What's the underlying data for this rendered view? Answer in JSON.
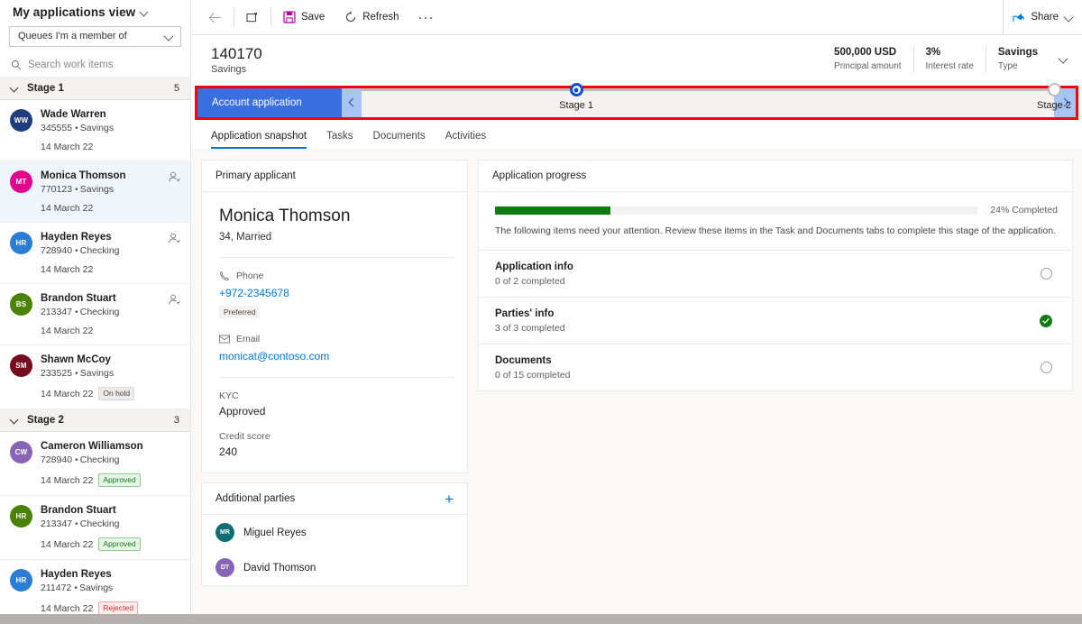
{
  "sidebar": {
    "view_title": "My applications view",
    "queue_selector_value": "Queues I'm a member of",
    "search_placeholder": "Search work items",
    "groups": [
      {
        "name": "Stage 1",
        "count": "5",
        "items": [
          {
            "initials": "WW",
            "color": "#1f3d7a",
            "name": "Wade Warren",
            "id": "345555",
            "type": "Savings",
            "date": "14 March 22",
            "badge": "",
            "badge_kind": "",
            "assign_icon": false,
            "selected": false
          },
          {
            "initials": "MT",
            "color": "#e3008c",
            "name": "Monica Thomson",
            "id": "770123",
            "type": "Savings",
            "date": "14 March 22",
            "badge": "",
            "badge_kind": "",
            "assign_icon": true,
            "selected": true
          },
          {
            "initials": "HR",
            "color": "#2b7cd3",
            "name": "Hayden Reyes",
            "id": "728940",
            "type": "Checking",
            "date": "14 March 22",
            "badge": "",
            "badge_kind": "",
            "assign_icon": true,
            "selected": false
          },
          {
            "initials": "BS",
            "color": "#498205",
            "name": "Brandon Stuart",
            "id": "213347",
            "type": "Checking",
            "date": "14 March 22",
            "badge": "",
            "badge_kind": "",
            "assign_icon": true,
            "selected": false
          },
          {
            "initials": "SM",
            "color": "#750b1c",
            "name": "Shawn McCoy",
            "id": "233525",
            "type": "Savings",
            "date": "14 March 22",
            "badge": "On hold",
            "badge_kind": "hold",
            "assign_icon": false,
            "selected": false
          }
        ]
      },
      {
        "name": "Stage 2",
        "count": "3",
        "items": [
          {
            "initials": "CW",
            "color": "#8764b8",
            "name": "Cameron Williamson",
            "id": "728940",
            "type": "Checking",
            "date": "14 March 22",
            "badge": "Approved",
            "badge_kind": "approved",
            "assign_icon": false,
            "selected": false
          },
          {
            "initials": "HR",
            "color": "#498205",
            "name": "Brandon Stuart",
            "id": "213347",
            "type": "Checking",
            "date": "14 March 22",
            "badge": "Approved",
            "badge_kind": "approved",
            "assign_icon": false,
            "selected": false
          },
          {
            "initials": "HR",
            "color": "#2b7cd3",
            "name": "Hayden Reyes",
            "id": "211472",
            "type": "Savings",
            "date": "14 March 22",
            "badge": "Rejected",
            "badge_kind": "rejected",
            "assign_icon": false,
            "selected": false
          }
        ]
      }
    ],
    "separator_dot": "•"
  },
  "commandbar": {
    "back_icon": "back-arrow-icon",
    "new_icon": "new-window-icon",
    "save_label": "Save",
    "refresh_label": "Refresh",
    "overflow_label": "···",
    "share_label": "Share"
  },
  "record_header": {
    "title": "140170",
    "subtitle": "Savings",
    "metrics": [
      {
        "value": "500,000 USD",
        "label": "Principal amount"
      },
      {
        "value": "3%",
        "label": "Interest rate"
      },
      {
        "value": "Savings",
        "label": "Type"
      }
    ]
  },
  "process_flow": {
    "pill_label": "Account application",
    "stages": [
      {
        "label": "Stage 1",
        "state": "active"
      },
      {
        "label": "Stage 2",
        "state": "pending"
      }
    ],
    "prev_icon": "chevron-left-icon",
    "next_icon": "chevron-right-icon",
    "highlight_color": "#ff0000"
  },
  "tabs": [
    {
      "label": "Application snapshot",
      "active": true
    },
    {
      "label": "Tasks",
      "active": false
    },
    {
      "label": "Documents",
      "active": false
    },
    {
      "label": "Activities",
      "active": false
    }
  ],
  "primary_applicant": {
    "card_title": "Primary applicant",
    "name": "Monica Thomson",
    "meta": "34, Married",
    "phone_label": "Phone",
    "phone_value": "+972-2345678",
    "phone_tag": "Preferred",
    "email_label": "Email",
    "email_value": "monicat@contoso.com",
    "kyc_label": "KYC",
    "kyc_value": "Approved",
    "credit_label": "Credit score",
    "credit_value": "240"
  },
  "additional_parties": {
    "card_title": "Additional parties",
    "add_icon": "plus-icon",
    "parties": [
      {
        "initials": "MR",
        "color": "#0e6e73",
        "name": "Miguel Reyes"
      },
      {
        "initials": "DT",
        "color": "#8764b8",
        "name": "David Thomson"
      }
    ]
  },
  "application_progress": {
    "card_title": "Application progress",
    "percent_label": "24% Completed",
    "percent_value": 24,
    "bar_color": "#107c10",
    "note": "The following items need your attention. Review these items in the Task and Documents tabs to complete this stage of the application.",
    "checklist": [
      {
        "title": "Application info",
        "sub": "0 of 2 completed",
        "done": false
      },
      {
        "title": "Parties' info",
        "sub": "3 of 3 completed",
        "done": true
      },
      {
        "title": "Documents",
        "sub": "0 of 15 completed",
        "done": false
      }
    ]
  }
}
